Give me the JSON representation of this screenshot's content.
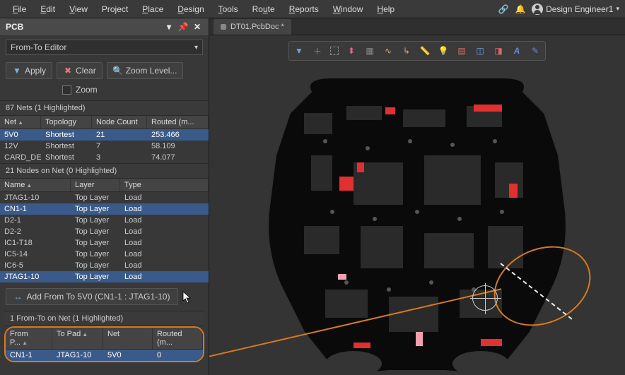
{
  "menu": {
    "items": [
      "File",
      "Edit",
      "View",
      "Project",
      "Place",
      "Design",
      "Tools",
      "Route",
      "Reports",
      "Window",
      "Help"
    ]
  },
  "user": {
    "name": "Design Engineer1"
  },
  "panel": {
    "title": "PCB"
  },
  "editor_dropdown": "From-To Editor",
  "buttons": {
    "apply": "Apply",
    "clear": "Clear",
    "zoom_level": "Zoom Level...",
    "zoom_chk": "Zoom"
  },
  "nets": {
    "header": "87 Nets (1 Highlighted)",
    "cols": [
      "Net",
      "Topology",
      "Node Count",
      "Routed (m..."
    ],
    "rows": [
      {
        "net": "5V0",
        "topology": "Shortest",
        "nodes": "21",
        "routed": "253.466",
        "sel": true
      },
      {
        "net": "12V",
        "topology": "Shortest",
        "nodes": "7",
        "routed": "58.109"
      },
      {
        "net": "CARD_DE",
        "topology": "Shortest",
        "nodes": "3",
        "routed": "74.077"
      }
    ]
  },
  "nodes_sec": {
    "header": "21 Nodes on Net (0 Highlighted)",
    "cols": [
      "Name",
      "Layer",
      "Type"
    ],
    "rows": [
      {
        "name": "JTAG1-10",
        "layer": "Top Layer",
        "type": "Load"
      },
      {
        "name": "CN1-1",
        "layer": "Top Layer",
        "type": "Load",
        "sel": true
      },
      {
        "name": "D2-1",
        "layer": "Top Layer",
        "type": "Load"
      },
      {
        "name": "D2-2",
        "layer": "Top Layer",
        "type": "Load"
      },
      {
        "name": "IC1-T18",
        "layer": "Top Layer",
        "type": "Load"
      },
      {
        "name": "IC5-14",
        "layer": "Top Layer",
        "type": "Load"
      },
      {
        "name": "IC6-5",
        "layer": "Top Layer",
        "type": "Load"
      },
      {
        "name": "JTAG1-10",
        "layer": "Top Layer",
        "type": "Load",
        "sel": true
      }
    ]
  },
  "add_btn": "Add From To 5V0 (CN1-1 : JTAG1-10)",
  "fromto": {
    "header": "1 From-To on Net (1 Highlighted)",
    "cols": [
      "From P...",
      "To Pad",
      "Net",
      "Routed (m..."
    ],
    "rows": [
      {
        "from": "CN1-1",
        "to": "JTAG1-10",
        "net": "5V0",
        "routed": "0",
        "sel": true
      }
    ]
  },
  "tab": {
    "name": "DT01.PcbDoc *"
  },
  "pcb_toolbar_icons": [
    "filter",
    "crosshair",
    "select-rect",
    "align",
    "grid",
    "wave",
    "route",
    "measure",
    "bulb",
    "layer",
    "clip-h",
    "clip-v",
    "text-a",
    "pencil"
  ]
}
